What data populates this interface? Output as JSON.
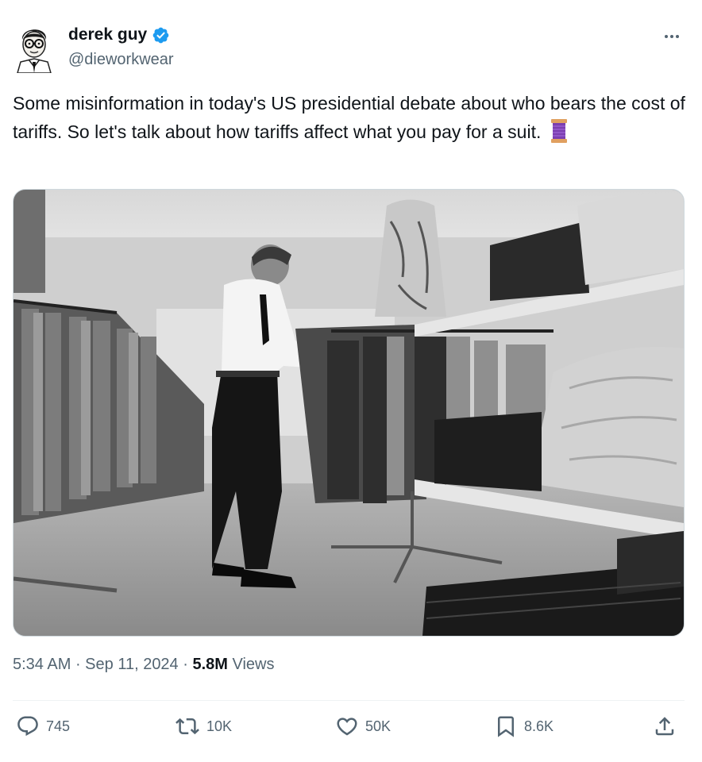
{
  "author": {
    "name": "derek guy",
    "handle": "@dieworkwear",
    "verified": true,
    "more_icon": "more-horizontal-icon"
  },
  "tweet": {
    "text": "Some misinformation in today's US presidential debate about who bears the cost of tariffs. So let's talk about how tariffs affect what you pay for a suit.",
    "emoji": "spool-of-thread-icon",
    "image": "black-and-white photo of a man in white shirt and tie browsing a clothing rack in a menswear store"
  },
  "meta": {
    "time": "5:34 AM",
    "date": "Sep 11, 2024",
    "views_count": "5.8M",
    "views_label": "Views"
  },
  "actions": {
    "replies": "745",
    "reposts": "10K",
    "likes": "50K",
    "bookmarks": "8.6K"
  },
  "colors": {
    "text": "#0f1419",
    "secondary": "#536471",
    "verified": "#1d9bf0"
  }
}
